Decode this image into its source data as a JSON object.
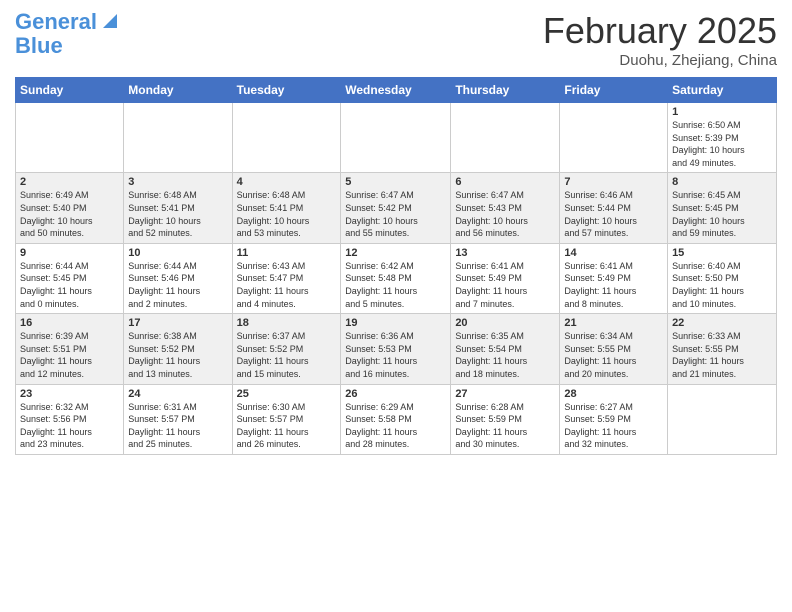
{
  "header": {
    "logo_line1": "General",
    "logo_line2": "Blue",
    "month_title": "February 2025",
    "location": "Duohu, Zhejiang, China"
  },
  "days_of_week": [
    "Sunday",
    "Monday",
    "Tuesday",
    "Wednesday",
    "Thursday",
    "Friday",
    "Saturday"
  ],
  "weeks": [
    [
      {
        "num": "",
        "info": ""
      },
      {
        "num": "",
        "info": ""
      },
      {
        "num": "",
        "info": ""
      },
      {
        "num": "",
        "info": ""
      },
      {
        "num": "",
        "info": ""
      },
      {
        "num": "",
        "info": ""
      },
      {
        "num": "1",
        "info": "Sunrise: 6:50 AM\nSunset: 5:39 PM\nDaylight: 10 hours\nand 49 minutes."
      }
    ],
    [
      {
        "num": "2",
        "info": "Sunrise: 6:49 AM\nSunset: 5:40 PM\nDaylight: 10 hours\nand 50 minutes."
      },
      {
        "num": "3",
        "info": "Sunrise: 6:48 AM\nSunset: 5:41 PM\nDaylight: 10 hours\nand 52 minutes."
      },
      {
        "num": "4",
        "info": "Sunrise: 6:48 AM\nSunset: 5:41 PM\nDaylight: 10 hours\nand 53 minutes."
      },
      {
        "num": "5",
        "info": "Sunrise: 6:47 AM\nSunset: 5:42 PM\nDaylight: 10 hours\nand 55 minutes."
      },
      {
        "num": "6",
        "info": "Sunrise: 6:47 AM\nSunset: 5:43 PM\nDaylight: 10 hours\nand 56 minutes."
      },
      {
        "num": "7",
        "info": "Sunrise: 6:46 AM\nSunset: 5:44 PM\nDaylight: 10 hours\nand 57 minutes."
      },
      {
        "num": "8",
        "info": "Sunrise: 6:45 AM\nSunset: 5:45 PM\nDaylight: 10 hours\nand 59 minutes."
      }
    ],
    [
      {
        "num": "9",
        "info": "Sunrise: 6:44 AM\nSunset: 5:45 PM\nDaylight: 11 hours\nand 0 minutes."
      },
      {
        "num": "10",
        "info": "Sunrise: 6:44 AM\nSunset: 5:46 PM\nDaylight: 11 hours\nand 2 minutes."
      },
      {
        "num": "11",
        "info": "Sunrise: 6:43 AM\nSunset: 5:47 PM\nDaylight: 11 hours\nand 4 minutes."
      },
      {
        "num": "12",
        "info": "Sunrise: 6:42 AM\nSunset: 5:48 PM\nDaylight: 11 hours\nand 5 minutes."
      },
      {
        "num": "13",
        "info": "Sunrise: 6:41 AM\nSunset: 5:49 PM\nDaylight: 11 hours\nand 7 minutes."
      },
      {
        "num": "14",
        "info": "Sunrise: 6:41 AM\nSunset: 5:49 PM\nDaylight: 11 hours\nand 8 minutes."
      },
      {
        "num": "15",
        "info": "Sunrise: 6:40 AM\nSunset: 5:50 PM\nDaylight: 11 hours\nand 10 minutes."
      }
    ],
    [
      {
        "num": "16",
        "info": "Sunrise: 6:39 AM\nSunset: 5:51 PM\nDaylight: 11 hours\nand 12 minutes."
      },
      {
        "num": "17",
        "info": "Sunrise: 6:38 AM\nSunset: 5:52 PM\nDaylight: 11 hours\nand 13 minutes."
      },
      {
        "num": "18",
        "info": "Sunrise: 6:37 AM\nSunset: 5:52 PM\nDaylight: 11 hours\nand 15 minutes."
      },
      {
        "num": "19",
        "info": "Sunrise: 6:36 AM\nSunset: 5:53 PM\nDaylight: 11 hours\nand 16 minutes."
      },
      {
        "num": "20",
        "info": "Sunrise: 6:35 AM\nSunset: 5:54 PM\nDaylight: 11 hours\nand 18 minutes."
      },
      {
        "num": "21",
        "info": "Sunrise: 6:34 AM\nSunset: 5:55 PM\nDaylight: 11 hours\nand 20 minutes."
      },
      {
        "num": "22",
        "info": "Sunrise: 6:33 AM\nSunset: 5:55 PM\nDaylight: 11 hours\nand 21 minutes."
      }
    ],
    [
      {
        "num": "23",
        "info": "Sunrise: 6:32 AM\nSunset: 5:56 PM\nDaylight: 11 hours\nand 23 minutes."
      },
      {
        "num": "24",
        "info": "Sunrise: 6:31 AM\nSunset: 5:57 PM\nDaylight: 11 hours\nand 25 minutes."
      },
      {
        "num": "25",
        "info": "Sunrise: 6:30 AM\nSunset: 5:57 PM\nDaylight: 11 hours\nand 26 minutes."
      },
      {
        "num": "26",
        "info": "Sunrise: 6:29 AM\nSunset: 5:58 PM\nDaylight: 11 hours\nand 28 minutes."
      },
      {
        "num": "27",
        "info": "Sunrise: 6:28 AM\nSunset: 5:59 PM\nDaylight: 11 hours\nand 30 minutes."
      },
      {
        "num": "28",
        "info": "Sunrise: 6:27 AM\nSunset: 5:59 PM\nDaylight: 11 hours\nand 32 minutes."
      },
      {
        "num": "",
        "info": ""
      }
    ]
  ]
}
